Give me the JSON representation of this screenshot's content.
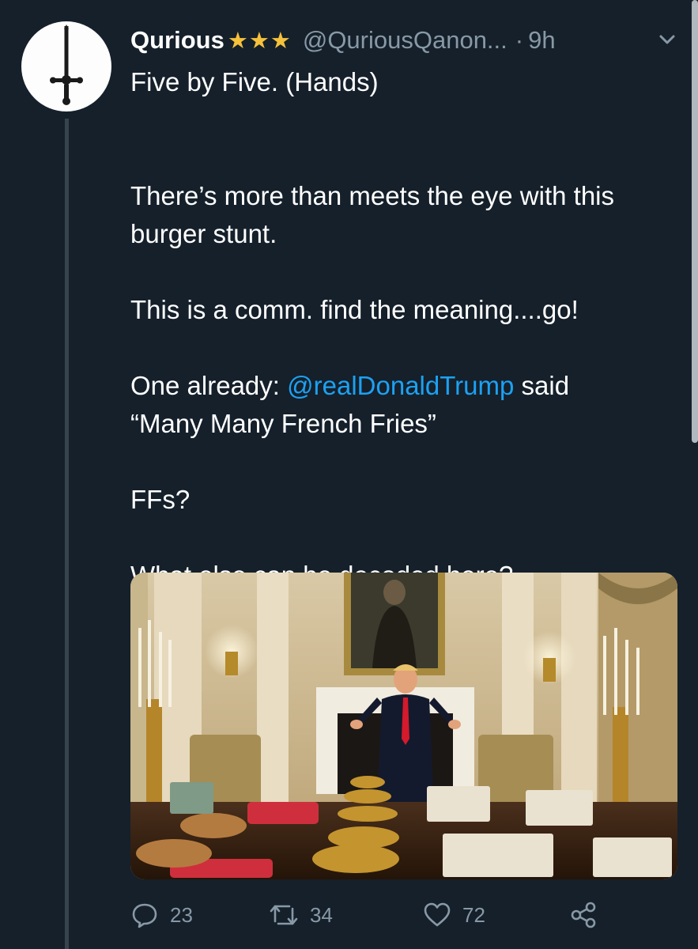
{
  "tweet": {
    "display_name": "Qurious",
    "stars": "★★★",
    "handle": "@QuriousQanon...",
    "separator": "·",
    "time": "9h",
    "lines": {
      "l1": "Five by Five. (Hands)",
      "l2": "There’s more than meets the eye with this",
      "l3": "burger stunt.",
      "l4": "This is a comm. find the meaning....go!",
      "l5_prefix": "One already: ",
      "l5_mention": "@realDonaldTrump",
      "l5_suffix": " said",
      "l6": "“Many Many French Fries”",
      "l7": "FFs?",
      "l8": "What else can be decoded here?"
    },
    "actions": {
      "replies": "23",
      "retweets": "34",
      "likes": "72"
    }
  },
  "icons": {
    "avatar": "sword-icon",
    "caret": "chevron-down-icon",
    "reply": "reply-icon",
    "retweet": "retweet-icon",
    "like": "heart-icon",
    "share": "share-icon"
  },
  "colors": {
    "background": "#15202b",
    "text": "#ffffff",
    "secondary": "#8899a6",
    "link": "#1da1f2",
    "star": "#f6c13b"
  }
}
